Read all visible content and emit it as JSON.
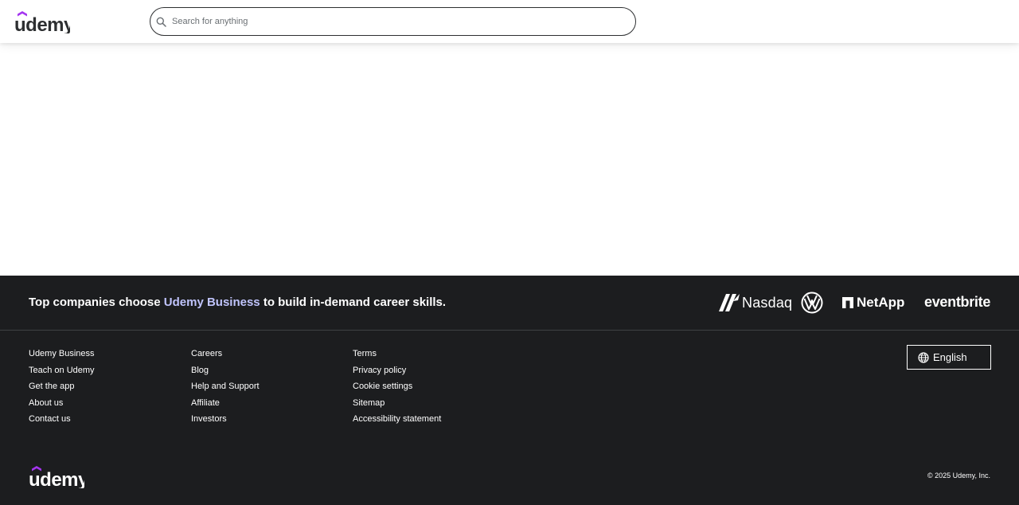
{
  "header": {
    "logo_text": "udemy",
    "search": {
      "placeholder": "Search for anything",
      "value": ""
    }
  },
  "footer": {
    "banner": {
      "text_before": "Top companies choose ",
      "highlight": "Udemy Business",
      "text_after": " to build in-demand career skills.",
      "partners": [
        "Nasdaq",
        "Volkswagen",
        "NetApp",
        "eventbrite"
      ],
      "nasdaq_label": "Nasdaq",
      "netapp_label": "NetApp",
      "eventbrite_label": "eventbrite"
    },
    "columns": [
      [
        "Udemy Business",
        "Teach on Udemy",
        "Get the app",
        "About us",
        "Contact us"
      ],
      [
        "Careers",
        "Blog",
        "Help and Support",
        "Affiliate",
        "Investors"
      ],
      [
        "Terms",
        "Privacy policy",
        "Cookie settings",
        "Sitemap",
        "Accessibility statement"
      ]
    ],
    "language_button": "English",
    "logo_text": "udemy",
    "copyright": "© 2025 Udemy, Inc."
  },
  "colors": {
    "brand_purple": "#a435f0",
    "footer_bg": "#1c1d1f",
    "highlight": "#c0c4fc",
    "text_dark": "#2d2f31"
  },
  "icons": [
    "udemy-logo",
    "search-icon",
    "nasdaq-logo",
    "volkswagen-logo",
    "netapp-logo",
    "eventbrite-logo",
    "globe-icon"
  ]
}
